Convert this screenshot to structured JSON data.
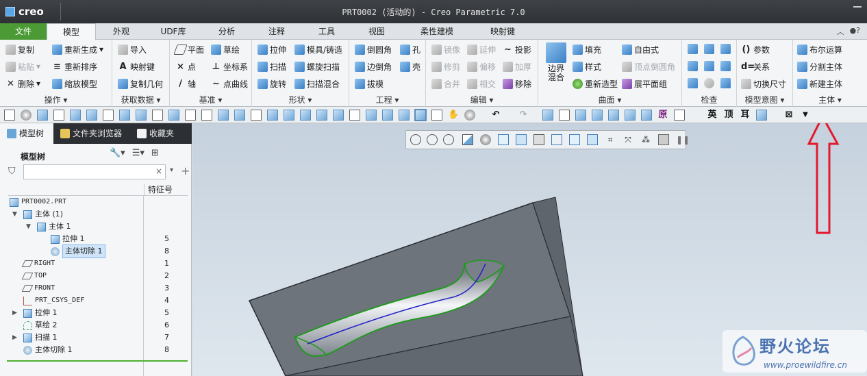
{
  "app": {
    "name": "creo",
    "window_title": "PRT0002 (活动的) - Creo Parametric 7.0"
  },
  "tabs": [
    "文件",
    "模型",
    "外观",
    "UDF库",
    "分析",
    "注释",
    "工具",
    "视图",
    "柔性建模",
    "映射键"
  ],
  "ribbon": {
    "operations": {
      "label": "操作",
      "items": [
        "复制",
        "粘贴",
        "删除",
        "重新生成",
        "重新排序",
        "缩放模型"
      ]
    },
    "get_data": {
      "label": "获取数据",
      "items": [
        "导入",
        "映射键",
        "复制几何"
      ]
    },
    "datum": {
      "label": "基准",
      "items": [
        "平面",
        "草绘",
        "点",
        "坐标系",
        "轴",
        "点曲线"
      ]
    },
    "shapes": {
      "label": "形状",
      "items": [
        "拉伸",
        "模具/铸造",
        "扫描",
        "螺旋扫描",
        "旋转",
        "扫描混合"
      ]
    },
    "engineering": {
      "label": "工程",
      "items": [
        "倒圆角",
        "孔",
        "边倒角",
        "壳",
        "拔模"
      ]
    },
    "editing": {
      "label": "编辑",
      "items": [
        "镜像",
        "延伸",
        "投影",
        "修剪",
        "偏移",
        "加厚",
        "合并",
        "相交",
        "移除"
      ]
    },
    "surfaces": {
      "label": "曲面",
      "items": [
        "边界混合",
        "填充",
        "自由式",
        "样式",
        "顶点倒圆角",
        "重新造型",
        "展平面组"
      ]
    },
    "inspect": {
      "label": "检查"
    },
    "model_intent": {
      "label": "模型意图",
      "items": [
        "参数",
        "关系",
        "切换尺寸"
      ]
    },
    "body": {
      "label": "主体",
      "items": [
        "布尔运算",
        "分割主体",
        "新建主体"
      ]
    }
  },
  "toolbar_text_buttons": [
    "原",
    "英",
    "顶",
    "耳"
  ],
  "panel": {
    "tabs": [
      "模型树",
      "文件夹浏览器",
      "收藏夹"
    ],
    "tree_title": "模型树",
    "filter_clear": "×",
    "column_header": "特征号",
    "rows": [
      {
        "label": "PRT0002.PRT",
        "num": ""
      },
      {
        "label": "主体 (1)",
        "num": ""
      },
      {
        "label": "主体 1",
        "num": ""
      },
      {
        "label": "拉伸 1",
        "num": "5"
      },
      {
        "label": "主体切除 1",
        "num": "8"
      },
      {
        "label": "RIGHT",
        "num": "1"
      },
      {
        "label": "TOP",
        "num": "2"
      },
      {
        "label": "FRONT",
        "num": "3"
      },
      {
        "label": "PRT_CSYS_DEF",
        "num": "4"
      },
      {
        "label": "拉伸 1",
        "num": "5"
      },
      {
        "label": "草绘 2",
        "num": "6"
      },
      {
        "label": "扫描 1",
        "num": "7"
      },
      {
        "label": "主体切除 1",
        "num": "8"
      }
    ]
  },
  "watermark": {
    "title": "野火论坛",
    "url": "www.proewildfire.cn"
  },
  "colors": {
    "accent_green": "#4c9a35",
    "arrow_red": "#e3182b",
    "model_gray": "#6e747b"
  }
}
